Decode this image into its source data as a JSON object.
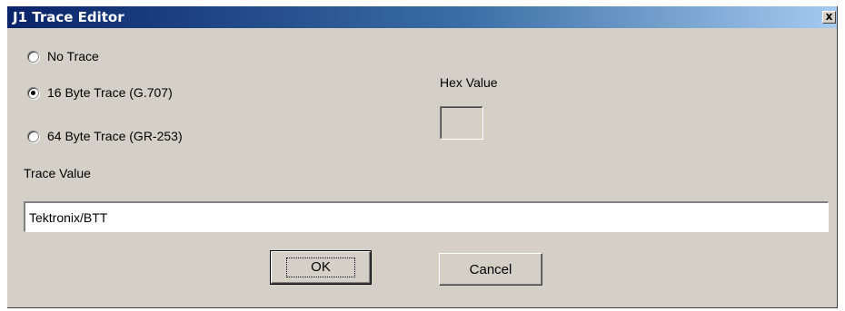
{
  "window": {
    "title": "J1 Trace Editor",
    "close_glyph": "x"
  },
  "trace_options": [
    {
      "label": "No Trace",
      "selected": false
    },
    {
      "label": "16 Byte Trace (G.707)",
      "selected": true
    },
    {
      "label": "64 Byte Trace (GR-253)",
      "selected": false
    }
  ],
  "hex": {
    "label": "Hex Value",
    "value": ""
  },
  "trace_value": {
    "label": "Trace Value",
    "value": "Tektronix/BTT"
  },
  "buttons": {
    "ok_label": "OK",
    "cancel_label": "Cancel"
  },
  "colors": {
    "face": "#d4d0c8",
    "title_start": "#0a246a",
    "title_end": "#a6caf0"
  }
}
